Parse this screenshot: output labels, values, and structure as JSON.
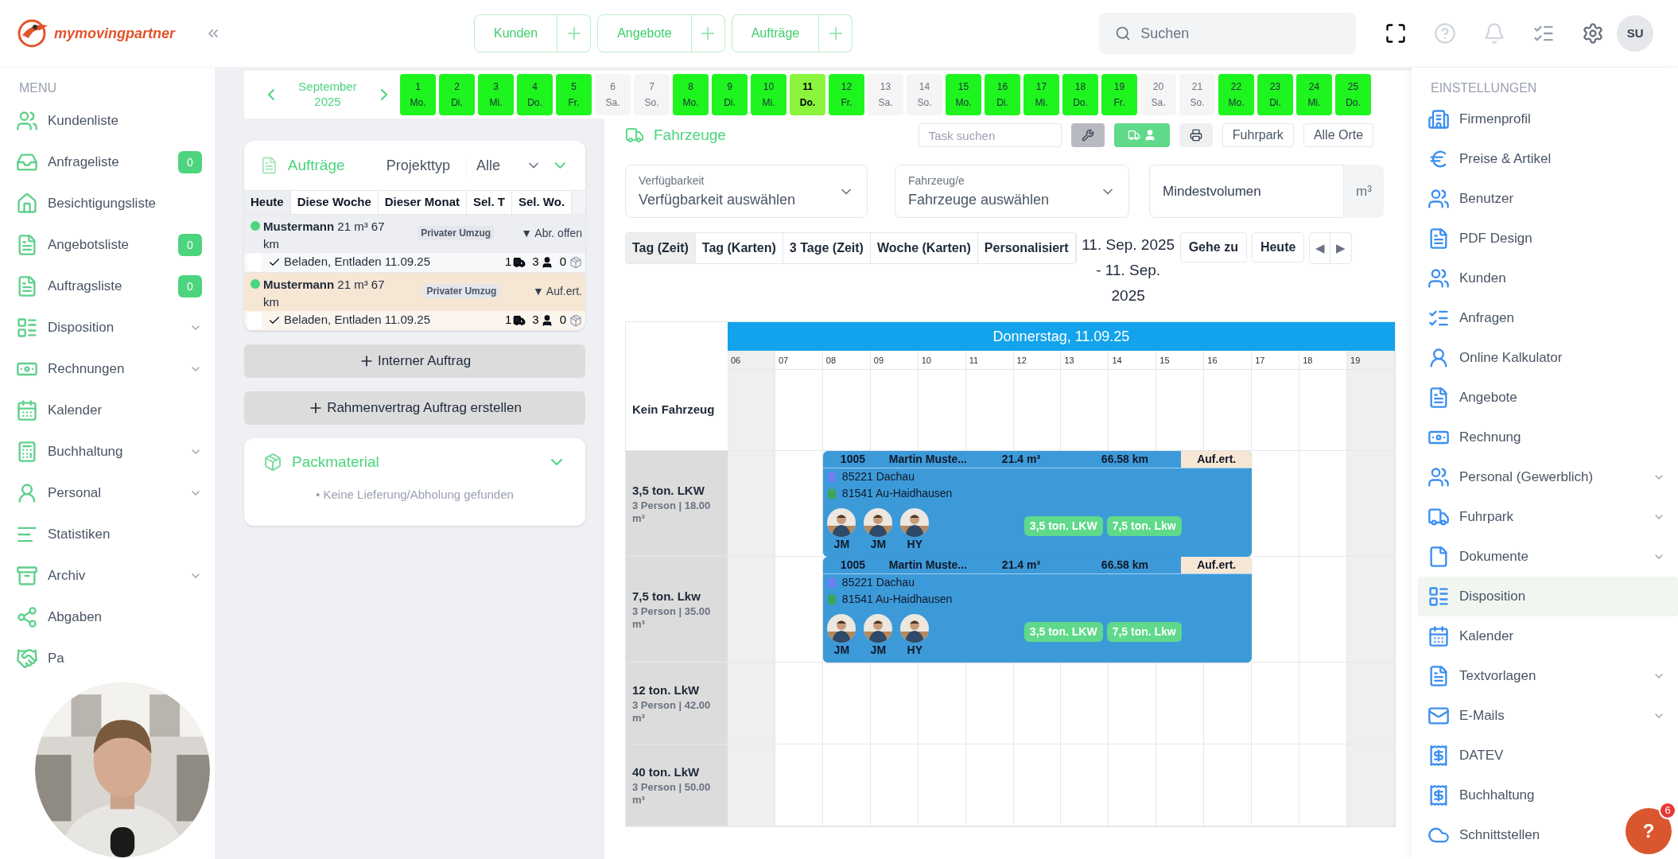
{
  "header": {
    "logo": "mymovingpartner",
    "quick_actions": [
      {
        "label": "Kunden"
      },
      {
        "label": "Angebote"
      },
      {
        "label": "Aufträge"
      }
    ],
    "search": {
      "placeholder": "Suchen"
    },
    "user": {
      "initials": "SU"
    }
  },
  "menu": {
    "title": "MENU",
    "items": [
      {
        "label": "Kundenliste",
        "kind": "link",
        "selected": false
      },
      {
        "label": "Anfrageliste",
        "kind": "link",
        "badge": "0",
        "selected": false
      },
      {
        "label": "Besichtigungsliste",
        "kind": "link",
        "selected": false
      },
      {
        "label": "Angebotsliste",
        "kind": "link",
        "badge": "0",
        "selected": false
      },
      {
        "label": "Auftragsliste",
        "kind": "link",
        "badge": "0",
        "selected": false
      },
      {
        "label": "Disposition",
        "kind": "group",
        "selected": false
      },
      {
        "label": "Rechnungen",
        "kind": "group",
        "selected": false
      },
      {
        "label": "Kalender",
        "kind": "link",
        "selected": false
      },
      {
        "label": "Buchhaltung",
        "kind": "group",
        "selected": false
      },
      {
        "label": "Personal",
        "kind": "group",
        "selected": false
      },
      {
        "label": "Statistiken",
        "kind": "link",
        "selected": false
      },
      {
        "label": "Archiv",
        "kind": "group",
        "selected": false
      },
      {
        "label": "Abgaben",
        "kind": "link",
        "selected": false
      },
      {
        "label": "Pa",
        "kind": "link",
        "selected": false
      }
    ]
  },
  "date_strip": {
    "month": "September",
    "year": "2025",
    "days": [
      {
        "day": "1",
        "weekday": "Mo.",
        "disabled": false,
        "selected": false
      },
      {
        "day": "2",
        "weekday": "Di.",
        "disabled": false,
        "selected": false
      },
      {
        "day": "3",
        "weekday": "Mi.",
        "disabled": false,
        "selected": false
      },
      {
        "day": "4",
        "weekday": "Do.",
        "disabled": false,
        "selected": false
      },
      {
        "day": "5",
        "weekday": "Fr.",
        "disabled": false,
        "selected": false
      },
      {
        "day": "6",
        "weekday": "Sa.",
        "disabled": true,
        "selected": false
      },
      {
        "day": "7",
        "weekday": "So.",
        "disabled": true,
        "selected": false
      },
      {
        "day": "8",
        "weekday": "Mo.",
        "disabled": false,
        "selected": false
      },
      {
        "day": "9",
        "weekday": "Di.",
        "disabled": false,
        "selected": false
      },
      {
        "day": "10",
        "weekday": "Mi.",
        "disabled": false,
        "selected": false
      },
      {
        "day": "11",
        "weekday": "Do.",
        "disabled": false,
        "selected": true
      },
      {
        "day": "12",
        "weekday": "Fr.",
        "disabled": false,
        "selected": false
      },
      {
        "day": "13",
        "weekday": "Sa.",
        "disabled": true,
        "selected": false
      },
      {
        "day": "14",
        "weekday": "So.",
        "disabled": true,
        "selected": false
      },
      {
        "day": "15",
        "weekday": "Mo.",
        "disabled": false,
        "selected": false
      },
      {
        "day": "16",
        "weekday": "Di.",
        "disabled": false,
        "selected": false
      },
      {
        "day": "17",
        "weekday": "Mi.",
        "disabled": false,
        "selected": false
      },
      {
        "day": "18",
        "weekday": "Do.",
        "disabled": false,
        "selected": false
      },
      {
        "day": "19",
        "weekday": "Fr.",
        "disabled": false,
        "selected": false
      },
      {
        "day": "20",
        "weekday": "Sa.",
        "disabled": true,
        "selected": false
      },
      {
        "day": "21",
        "weekday": "So.",
        "disabled": true,
        "selected": false
      },
      {
        "day": "22",
        "weekday": "Mo.",
        "disabled": false,
        "selected": false
      },
      {
        "day": "23",
        "weekday": "Di.",
        "disabled": false,
        "selected": false
      },
      {
        "day": "24",
        "weekday": "Mi.",
        "disabled": false,
        "selected": false
      },
      {
        "day": "25",
        "weekday": "Do.",
        "disabled": false,
        "selected": false
      }
    ]
  },
  "orders_panel": {
    "title": "Aufträge",
    "filter_label": "Projekttyp",
    "filter_value": "Alle",
    "tabs": [
      {
        "label": "Heute",
        "selected": true
      },
      {
        "label": "Diese Woche",
        "selected": false
      },
      {
        "label": "Dieser Monat",
        "selected": false
      },
      {
        "label": "Sel. T",
        "selected": false
      },
      {
        "label": "Sel. Wo.",
        "selected": false
      }
    ],
    "orders": [
      {
        "summary": "**Mustermann** 21 m³  67 km",
        "type": "Privater Umzug",
        "status": "▼ Abr. offen",
        "color": "#eceef1",
        "detail": "Beladen, Entladen 11.09.25",
        "trucks": "1",
        "persons": "3",
        "items": "0"
      },
      {
        "summary": "**Mustermann** 21 m³  67 km",
        "type": "Privater Umzug",
        "status": "▼ Auf.ert.",
        "color": "#f6e6d4",
        "detail": "Beladen, Entladen 11.09.25",
        "trucks": "1",
        "persons": "3",
        "items": "0"
      }
    ]
  },
  "actions": [
    "Interner Auftrag",
    "Rahmenvertrag Auftrag erstellen"
  ],
  "packmaterial": {
    "title": "Packmaterial",
    "empty": "• Keine Lieferung/Abholung gefunden"
  },
  "dispatch": {
    "title": "Fahrzeuge",
    "vehicle_toggle": {
      "on": true
    },
    "task_search": {
      "placeholder": "Task suchen"
    },
    "fleet_filter": "Fuhrpark",
    "location_filter": "Alle Orte",
    "availability": {
      "label": "Verfügbarkeit",
      "value": "Verfügbarkeit auswählen"
    },
    "vehicles": {
      "label": "Fahrzeug/e",
      "value": "Fahrzeuge auswählen"
    },
    "min_volume": {
      "placeholder": "Mindestvolumen",
      "unit": "m³"
    },
    "views": [
      {
        "label": "Tag (Zeit)",
        "selected": true
      },
      {
        "label": "Tag (Karten)",
        "selected": false
      },
      {
        "label": "3 Tage (Zeit)",
        "selected": false
      },
      {
        "label": "Woche (Karten)",
        "selected": false
      },
      {
        "label": "Personalisiert",
        "selected": false
      }
    ],
    "range": "11. Sep. 2025 - 11. Sep. 2025",
    "goto": "Gehe zu",
    "today": "Heute",
    "prev": "◀",
    "next": "▶",
    "calendar": {
      "day": "Donnerstag, 11.09.25",
      "hours": [
        {
          "label": "06",
          "off": true
        },
        {
          "label": "07",
          "off": false
        },
        {
          "label": "08",
          "off": false
        },
        {
          "label": "09",
          "off": false
        },
        {
          "label": "10",
          "off": false
        },
        {
          "label": "11",
          "off": false
        },
        {
          "label": "12",
          "off": false
        },
        {
          "label": "13",
          "off": false
        },
        {
          "label": "14",
          "off": false
        },
        {
          "label": "15",
          "off": false
        },
        {
          "label": "16",
          "off": false
        },
        {
          "label": "17",
          "off": false
        },
        {
          "label": "18",
          "off": false
        },
        {
          "label": "19",
          "off": true
        }
      ],
      "rows": [
        {
          "kind": "unassigned",
          "name": "Kein Fahrzeug",
          "events": []
        },
        {
          "kind": "vehicle",
          "name": "3,5 ton. LKW",
          "info": "3 Person | 18.00 m³",
          "events": [
            {
              "number": "1005",
              "customer": "Martin Muste...",
              "volume": "21.4 m³",
              "distance": "66.58 km",
              "status": "Auf.ert.",
              "addresses": [
                {
                  "text": "85221 Dachau",
                  "color": "#6d7ff2"
                },
                {
                  "text": "81541 Au-Haidhausen",
                  "color": "#3ba55a"
                }
              ],
              "crew": [
                {
                  "initials": "JM"
                },
                {
                  "initials": "JM"
                },
                {
                  "initials": "HY"
                }
              ],
              "vehicles": [
                "3,5 ton. LKW",
                "7,5 ton. Lkw"
              ]
            }
          ]
        },
        {
          "kind": "vehicle",
          "name": "7,5 ton. Lkw",
          "info": "3 Person | 35.00 m³",
          "events": [
            {
              "number": "1005",
              "customer": "Martin Muste...",
              "volume": "21.4 m³",
              "distance": "66.58 km",
              "status": "Auf.ert.",
              "addresses": [
                {
                  "text": "85221 Dachau",
                  "color": "#6d7ff2"
                },
                {
                  "text": "81541 Au-Haidhausen",
                  "color": "#3ba55a"
                }
              ],
              "crew": [
                {
                  "initials": "JM"
                },
                {
                  "initials": "JM"
                },
                {
                  "initials": "HY"
                }
              ],
              "vehicles": [
                "3,5 ton. LKW",
                "7,5 ton. Lkw"
              ]
            }
          ]
        },
        {
          "kind": "vehicle",
          "name": "12 ton. LkW",
          "info": "3 Person | 42.00 m³",
          "events": []
        },
        {
          "kind": "vehicle",
          "name": "40 ton. LkW",
          "info": "3 Person | 50.00 m³",
          "events": []
        }
      ]
    }
  },
  "settings": {
    "title": "EINSTELLUNGEN",
    "items": [
      {
        "label": "Firmenprofil",
        "kind": "link",
        "selected": false
      },
      {
        "label": "Preise & Artikel",
        "kind": "link",
        "selected": false
      },
      {
        "label": "Benutzer",
        "kind": "link",
        "selected": false
      },
      {
        "label": "PDF Design",
        "kind": "link",
        "selected": false
      },
      {
        "label": "Kunden",
        "kind": "link",
        "selected": false
      },
      {
        "label": "Anfragen",
        "kind": "link",
        "selected": false
      },
      {
        "label": "Online Kalkulator",
        "kind": "link",
        "selected": false
      },
      {
        "label": "Angebote",
        "kind": "link",
        "selected": false
      },
      {
        "label": "Rechnung",
        "kind": "link",
        "selected": false
      },
      {
        "label": "Personal (Gewerblich)",
        "kind": "group",
        "selected": false
      },
      {
        "label": "Fuhrpark",
        "kind": "group",
        "selected": false
      },
      {
        "label": "Dokumente",
        "kind": "group",
        "selected": false
      },
      {
        "label": "Disposition",
        "kind": "link",
        "selected": true
      },
      {
        "label": "Kalender",
        "kind": "link",
        "selected": false
      },
      {
        "label": "Textvorlagen",
        "kind": "group",
        "selected": false
      },
      {
        "label": "E-Mails",
        "kind": "group",
        "selected": false
      },
      {
        "label": "DATEV",
        "kind": "link",
        "selected": false
      },
      {
        "label": "Buchhaltung",
        "kind": "link",
        "selected": false
      },
      {
        "label": "Schnittstellen",
        "kind": "link",
        "selected": false
      }
    ]
  },
  "help": {
    "label": "?",
    "badge": "6"
  }
}
